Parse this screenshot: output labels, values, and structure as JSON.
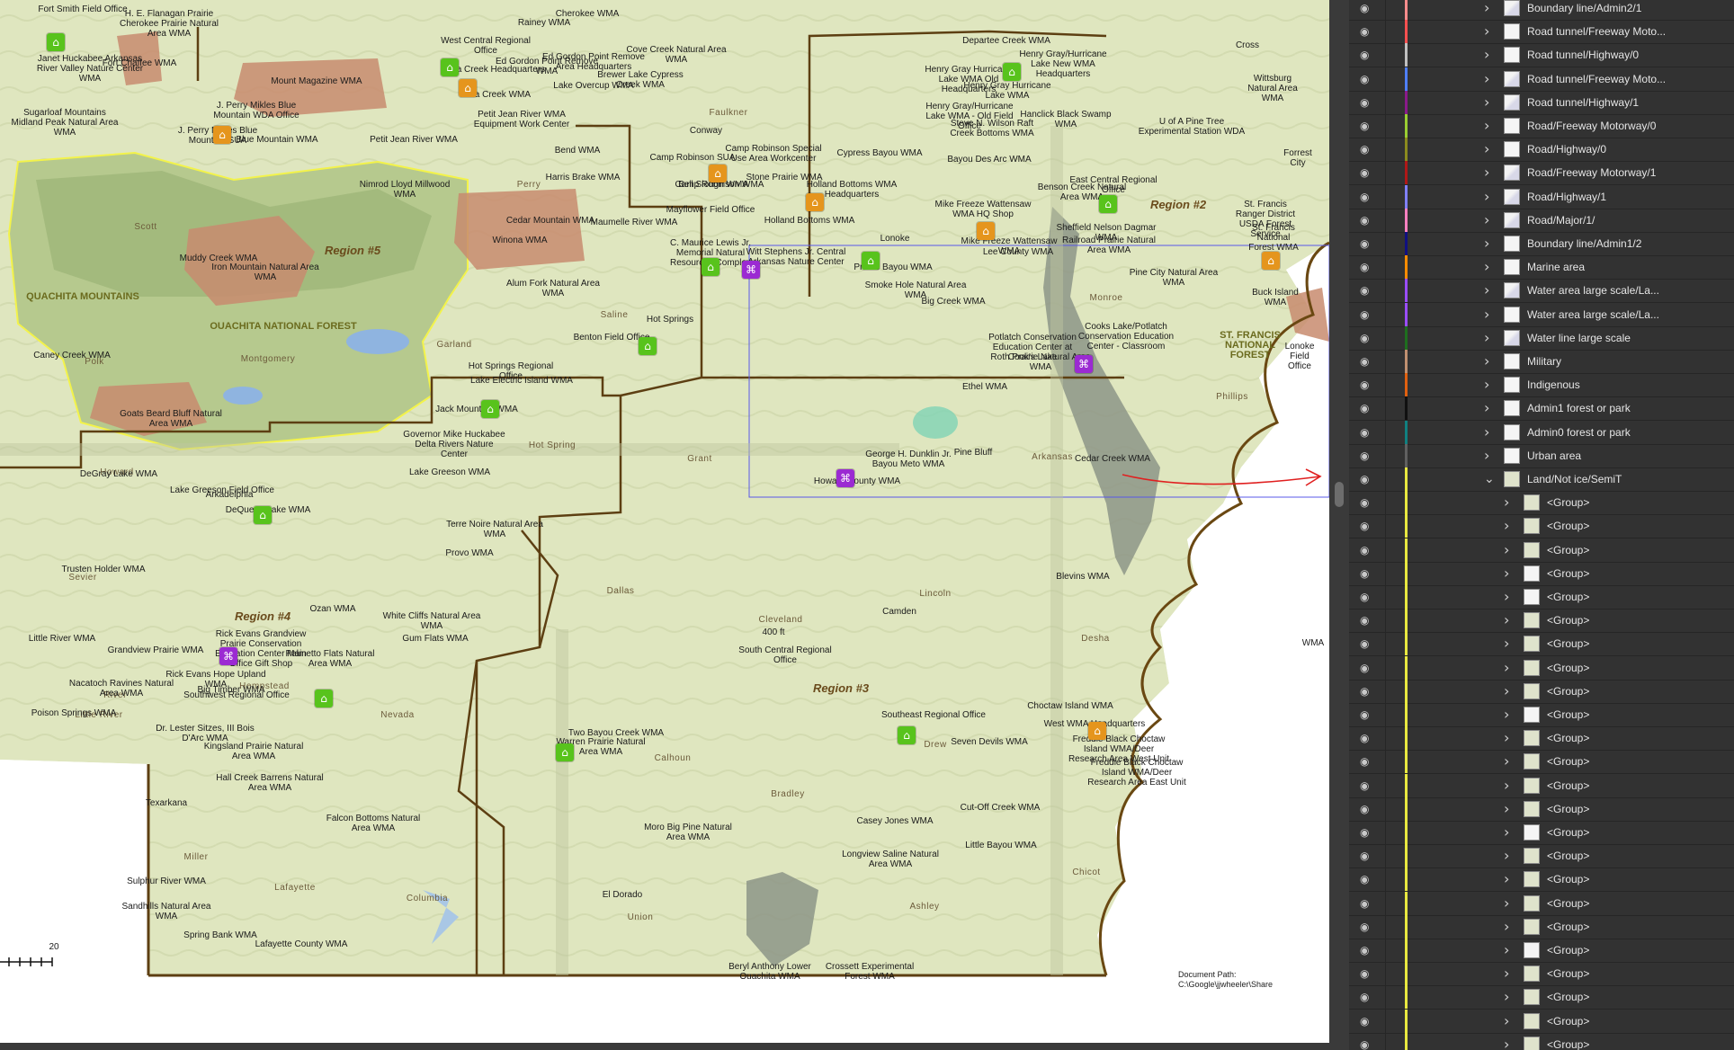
{
  "document_path": "Document Path: C:\\Google\\jjwheeler\\Share",
  "scale_label": "20",
  "region_labels": [
    "Region #2",
    "Region #3",
    "Region #4",
    "Region #5"
  ],
  "forest_labels": [
    "OUACHITA NATIONAL FOREST",
    "ST. FRANCIS NATIONAL FOREST",
    "QUACHITA MOUNTAINS"
  ],
  "county_labels": [
    "Perry",
    "Scott",
    "Saline",
    "Garland",
    "Montgomery",
    "Polk",
    "Faulkner",
    "Grant",
    "Hot Spring",
    "Howard",
    "Sevier",
    "Dallas",
    "Cleveland",
    "Lincoln",
    "Desha",
    "Arkansas",
    "Monroe",
    "Phillips",
    "Nevada",
    "Calhoun",
    "Bradley",
    "Drew",
    "Chicot",
    "Ashley",
    "Union",
    "Columbia",
    "Lafayette",
    "Miller",
    "Hempstead",
    "River",
    "Little River"
  ],
  "place_labels": [
    "Fort Smith Field Office",
    "H. E. Flanagan Prairie Cherokee Prairie Natural Area WMA",
    "Cherokee WMA",
    "Rainey WMA",
    "Janet Huckabee Arkansas River Valley Nature Center WMA",
    "Fort Chaffee WMA",
    "Sugarloaf Mountains Midland Peak Natural Area WMA",
    "Mount Magazine WMA",
    "J. Perry Mikles Blue Mountain WDA Office",
    "J. Perry Mikles Blue Mountain SUA",
    "Blue Mountain WMA",
    "Petit Jean River WMA",
    "West Central Regional Office",
    "Galla Creek Headquarters",
    "Ed Gordon Point Remove WMA",
    "Ed Gordon Point Remove Area Headquarters",
    "Cove Creek Natural Area WMA",
    "Lake Overcup WMA",
    "Brewer Lake Cypress Creek WMA",
    "Petit Jean River WMA Equipment Work Center",
    "Galla Creek WMA",
    "Bell Slough WMA",
    "Camp Robinson SUA",
    "Camp Robinson Special Use Area Workcenter",
    "Stone Prairie WMA",
    "Mayflower Field Office",
    "Camp Robinson WMA",
    "Harris Brake WMA",
    "Bend WMA",
    "Conway",
    "Nimrod Lloyd Millwood WMA",
    "Cedar Mountain WMA",
    "Winona WMA",
    "Maumelle River WMA",
    "C. Maurice Lewis Jr. Memorial Natural Resources Complex",
    "Witt Stephens Jr. Central Arkansas Nature Center",
    "Alum Fork Natural Area WMA",
    "Holland Bottoms WMA Headquarters",
    "Holland Bottoms WMA",
    "Cypress Bayou WMA",
    "Henry Gray Hurricane Lake WMA Old Headquarters",
    "Henry Gray/Hurricane Lake WMA - Old Field Office",
    "Departee Creek WMA",
    "Henry Gray/Hurricane Lake New WMA Headquarters",
    "Henry Gray Hurricane Lake WMA",
    "Steve N. Wilson Raft Creek Bottoms WMA",
    "Hanclick Black Swamp WMA",
    "U of A Pine Tree Experimental Station WDA",
    "Wittsburg Natural Area WMA",
    "Cross",
    "Forrest City",
    "Bayou Des Arc WMA",
    "Benson Creek Natural Area WMA",
    "Sheffield Nelson Dagmar WMA",
    "East Central Regional Office",
    "Mike Freeze Wattensaw WMA HQ Shop",
    "Mike Freeze Wattensaw WMA",
    "Railroad Prairie Natural Area WMA",
    "Lee County WMA",
    "St. Francis Ranger District USDA Forest Service",
    "St. Francis National Forest WMA",
    "Buck Island WMA",
    "Lonoke Field Office",
    "Lonoke",
    "Prairie Bayou WMA",
    "Smoke Hole Natural Area WMA",
    "Big Creek WMA",
    "Pine City Natural Area WMA",
    "Cooks Lake/Potlatch Conservation Education Center - Classroom",
    "Potlatch Conservation Education Center at Cook's Lake",
    "Roth Prairie Natural Area WMA",
    "Ethel WMA",
    "Cedar Creek WMA",
    "Muddy Creek WMA",
    "Iron Mountain Natural Area WMA",
    "Caney Creek WMA",
    "Goats Beard Bluff Natural Area WMA",
    "Benton Field Office",
    "Hot Springs",
    "Hot Springs Regional Office",
    "Lake Electric Island WMA",
    "Jack Mountain WMA",
    "Governor Mike Huckabee Delta Rivers Nature Center",
    "George H. Dunklin Jr. Bayou Meto WMA",
    "Pine Bluff",
    "Howard County WMA",
    "DeGray Lake WMA",
    "Lake Greeson WMA",
    "Lake Greeson Field Office",
    "DeQueen Lake WMA",
    "Arkadelphia",
    "Terre Noire Natural Area WMA",
    "Provo WMA",
    "Trusten Holder WMA",
    "Blevins WMA",
    "Ozan WMA",
    "Rick Evans Grandview Prairie Conservation Education Center Main Office Gift Shop",
    "White Cliffs Natural Area WMA",
    "Grandview Prairie WMA",
    "Nacatoch Ravines Natural Area WMA",
    "Rick Evans Hope Upland WMA",
    "Big Timber WMA",
    "Southwest Regional Office",
    "Gum Flats WMA",
    "Palmetto Flats Natural Area WMA",
    "Little River WMA",
    "Poison Springs WMA",
    "Dr. Lester Sitzes, III Bois D'Arc WMA",
    "Kingsland Prairie Natural Area WMA",
    "Hall Creek Barrens Natural Area WMA",
    "400 ft",
    "South Central Regional Office",
    "Camden",
    "Two Bayou Creek WMA",
    "Warren Prairie Natural Area WMA",
    "Southeast Regional Office",
    "Seven Devils WMA",
    "Choctaw Island WMA",
    "West WMA Headquarters",
    "Freddie Black Choctaw Island WMA/Deer Research Area West Unit",
    "Freddie Black Choctaw Island WMA/Deer Research Area East Unit",
    "Cut-Off Creek WMA",
    "Moro Big Pine Natural Area WMA",
    "Casey Jones WMA",
    "Longview Saline Natural Area WMA",
    "Little Bayou WMA",
    "Texarkana",
    "Sulphur River WMA",
    "Sandhills Natural Area WMA",
    "Falcon Bottoms Natural Area WMA",
    "Spring Bank WMA",
    "Lafayette County WMA",
    "El Dorado",
    "Beryl Anthony Lower Ouachita WMA",
    "Crossett Experimental Forest WMA",
    "WMA"
  ],
  "layers_panel": {
    "rows": [
      {
        "name": "Boundary line/Admin2/1",
        "color": "#ff8c8c",
        "thumb": "map",
        "expanded": false,
        "indent": 0
      },
      {
        "name": "Road tunnel/Freeway Moto...",
        "color": "#ff5050",
        "thumb": "blank",
        "expanded": false,
        "indent": 0
      },
      {
        "name": "Road tunnel/Highway/0",
        "color": "#c0c0c0",
        "thumb": "blank",
        "expanded": false,
        "indent": 0
      },
      {
        "name": "Road tunnel/Freeway Moto...",
        "color": "#4f7fff",
        "thumb": "map",
        "expanded": false,
        "indent": 0
      },
      {
        "name": "Road tunnel/Highway/1",
        "color": "#8a1a8a",
        "thumb": "map",
        "expanded": false,
        "indent": 0
      },
      {
        "name": "Road/Freeway Motorway/0",
        "color": "#9acd32",
        "thumb": "blank",
        "expanded": false,
        "indent": 0
      },
      {
        "name": "Road/Highway/0",
        "color": "#8b8b1e",
        "thumb": "blank",
        "expanded": false,
        "indent": 0
      },
      {
        "name": "Road/Freeway Motorway/1",
        "color": "#b01818",
        "thumb": "map",
        "expanded": false,
        "indent": 0
      },
      {
        "name": "Road/Highway/1",
        "color": "#8080ff",
        "thumb": "map",
        "expanded": false,
        "indent": 0
      },
      {
        "name": "Road/Major/1/",
        "color": "#ff80c0",
        "thumb": "map",
        "expanded": false,
        "indent": 0
      },
      {
        "name": "Boundary line/Admin1/2",
        "color": "#101080",
        "thumb": "blank",
        "expanded": false,
        "indent": 0
      },
      {
        "name": "Marine area",
        "color": "#ff8c00",
        "thumb": "blank",
        "expanded": false,
        "indent": 0
      },
      {
        "name": "Water area large scale/La...",
        "color": "#9a4dff",
        "thumb": "map",
        "expanded": false,
        "indent": 0
      },
      {
        "name": "Water area large scale/La...",
        "color": "#9a4dff",
        "thumb": "blank",
        "expanded": false,
        "indent": 0
      },
      {
        "name": "Water line large scale",
        "color": "#1e6e1e",
        "thumb": "map",
        "expanded": false,
        "indent": 0
      },
      {
        "name": "Military",
        "color": "#c09070",
        "thumb": "blank",
        "expanded": false,
        "indent": 0
      },
      {
        "name": "Indigenous",
        "color": "#e06010",
        "thumb": "blank",
        "expanded": false,
        "indent": 0
      },
      {
        "name": "Admin1 forest or park",
        "color": "#101010",
        "thumb": "blank",
        "expanded": false,
        "indent": 0
      },
      {
        "name": "Admin0 forest or park",
        "color": "#108080",
        "thumb": "blank",
        "expanded": false,
        "indent": 0
      },
      {
        "name": "Urban area",
        "color": "#606060",
        "thumb": "blank",
        "expanded": false,
        "indent": 0
      },
      {
        "name": "Land/Not ice/SemiT",
        "color": "#e8e840",
        "thumb": "land",
        "expanded": true,
        "indent": 0
      },
      {
        "name": "<Group>",
        "color": "#e8e840",
        "thumb": "land",
        "expanded": false,
        "indent": 1
      },
      {
        "name": "<Group>",
        "color": "#e8e840",
        "thumb": "land",
        "expanded": false,
        "indent": 1
      },
      {
        "name": "<Group>",
        "color": "#e8e840",
        "thumb": "land",
        "expanded": false,
        "indent": 1
      },
      {
        "name": "<Group>",
        "color": "#e8e840",
        "thumb": "blank",
        "expanded": false,
        "indent": 1
      },
      {
        "name": "<Group>",
        "color": "#e8e840",
        "thumb": "blank",
        "expanded": false,
        "indent": 1
      },
      {
        "name": "<Group>",
        "color": "#e8e840",
        "thumb": "land",
        "expanded": false,
        "indent": 1
      },
      {
        "name": "<Group>",
        "color": "#e8e840",
        "thumb": "land",
        "expanded": false,
        "indent": 1
      },
      {
        "name": "<Group>",
        "color": "#e8e840",
        "thumb": "land",
        "expanded": false,
        "indent": 1
      },
      {
        "name": "<Group>",
        "color": "#e8e840",
        "thumb": "land",
        "expanded": false,
        "indent": 1
      },
      {
        "name": "<Group>",
        "color": "#e8e840",
        "thumb": "blank",
        "expanded": false,
        "indent": 1
      },
      {
        "name": "<Group>",
        "color": "#e8e840",
        "thumb": "land",
        "expanded": false,
        "indent": 1
      },
      {
        "name": "<Group>",
        "color": "#e8e840",
        "thumb": "land",
        "expanded": false,
        "indent": 1
      },
      {
        "name": "<Group>",
        "color": "#e8e840",
        "thumb": "land",
        "expanded": false,
        "indent": 1
      },
      {
        "name": "<Group>",
        "color": "#e8e840",
        "thumb": "land",
        "expanded": false,
        "indent": 1
      },
      {
        "name": "<Group>",
        "color": "#e8e840",
        "thumb": "blank",
        "expanded": false,
        "indent": 1
      },
      {
        "name": "<Group>",
        "color": "#e8e840",
        "thumb": "land",
        "expanded": false,
        "indent": 1
      },
      {
        "name": "<Group>",
        "color": "#e8e840",
        "thumb": "land",
        "expanded": false,
        "indent": 1
      },
      {
        "name": "<Group>",
        "color": "#e8e840",
        "thumb": "land",
        "expanded": false,
        "indent": 1
      },
      {
        "name": "<Group>",
        "color": "#e8e840",
        "thumb": "land",
        "expanded": false,
        "indent": 1
      },
      {
        "name": "<Group>",
        "color": "#e8e840",
        "thumb": "blank",
        "expanded": false,
        "indent": 1
      },
      {
        "name": "<Group>",
        "color": "#e8e840",
        "thumb": "land",
        "expanded": false,
        "indent": 1
      },
      {
        "name": "<Group>",
        "color": "#e8e840",
        "thumb": "land",
        "expanded": false,
        "indent": 1
      },
      {
        "name": "<Group>",
        "color": "#e8e840",
        "thumb": "land",
        "expanded": false,
        "indent": 1
      },
      {
        "name": "<Group>",
        "color": "#e8e840",
        "thumb": "land",
        "expanded": false,
        "indent": 1
      }
    ]
  },
  "icons": {
    "visibility": "eye-icon",
    "expand": "chevron-right-icon",
    "collapse": "chevron-down-icon"
  }
}
